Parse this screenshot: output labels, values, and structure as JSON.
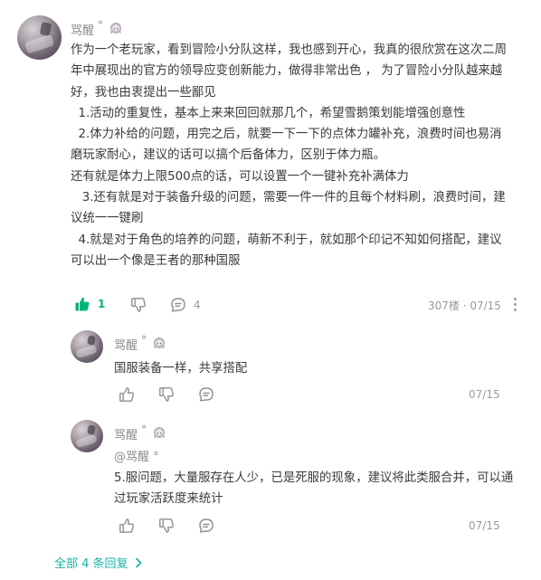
{
  "main_comment": {
    "username": "骂醒",
    "degree": "°",
    "badge_icon": "anime-girl-badge-icon",
    "paragraphs": [
      "作为一个老玩家，看到冒险小分队这样，我也感到开心，我真的很欣赏在这次二周",
      "年中展现出的官方的领导应变创新能力，做得非常出色 ， 为了冒险小分队越来越",
      "好，我也由衷提出一些鄙见",
      "  1.活动的重复性，基本上来来回回就那几个，希望雪鹅策划能增强创意性",
      "  2.体力补给的问题，用完之后，就要一下一下的点体力罐补充，浪费时间也易消",
      "磨玩家耐心，建议的话可以搞个后备体力，区别于体力瓶。",
      "还有就是体力上限500点的话，可以设置一个一键补充补满体力",
      "   3.还有就是对于装备升级的问题，需要一件一件的且每个材料刷，浪费时间，建",
      "议统一一键刷",
      "  4.就是对于角色的培养的问题，萌新不利于，就如那个印记不知如何搭配，建议",
      "可以出一个像是王者的那种国服"
    ],
    "like_count": "1",
    "reply_count": "4",
    "meta": "307楼 · 07/15",
    "accent_color": "#00b578"
  },
  "replies": [
    {
      "username": "骂醒",
      "degree": "°",
      "mention": "",
      "text_lines": [
        "国服装备一样，共享搭配"
      ],
      "date": "07/15"
    },
    {
      "username": "骂醒",
      "degree": "°",
      "mention": "@骂醒 °",
      "text_lines": [
        "5.服问题，大量服存在人少，已是死服的现象，建议将此类服合并，可以通",
        "过玩家活跃度来统计"
      ],
      "date": "07/15"
    }
  ],
  "footer": {
    "all_replies_label": "全部 4 条回复",
    "link_color": "#17b3a3"
  }
}
